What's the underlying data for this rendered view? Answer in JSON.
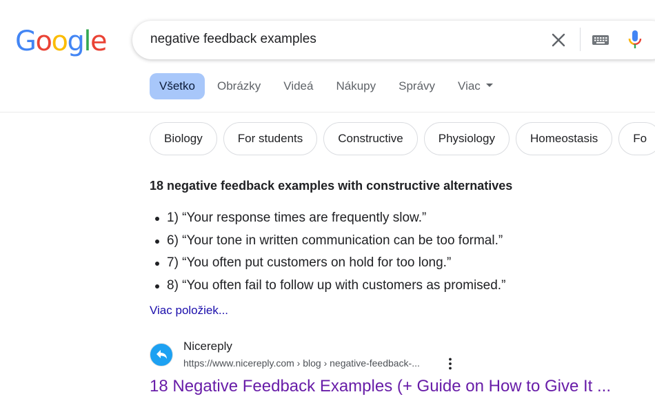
{
  "logo": {
    "letters": [
      "G",
      "o",
      "o",
      "g",
      "l",
      "e"
    ],
    "colors": [
      "#4285F4",
      "#EA4335",
      "#FBBC05",
      "#4285F4",
      "#34A853",
      "#EA4335"
    ]
  },
  "search": {
    "query": "negative feedback examples"
  },
  "icons": {
    "clear": "close-icon",
    "keyboard": "keyboard-icon",
    "mic": "microphone-icon",
    "more": "more-vert-icon"
  },
  "tabs": [
    {
      "label": "Všetko",
      "active": true
    },
    {
      "label": "Obrázky"
    },
    {
      "label": "Videá"
    },
    {
      "label": "Nákupy"
    },
    {
      "label": "Správy"
    },
    {
      "label": "Viac"
    }
  ],
  "chips": [
    "Biology",
    "For students",
    "Constructive",
    "Physiology",
    "Homeostasis",
    "Fo"
  ],
  "snippet": {
    "title": "18 negative feedback examples with constructive alternatives",
    "items": [
      "1) “Your response times are frequently slow.”",
      "6) “Your tone in written communication can be too formal.”",
      "7) “You often put customers on hold for too long.”",
      "8) “You often fail to follow up with customers as promised.”"
    ],
    "more_label": "Viac položiek..."
  },
  "result": {
    "site_name": "Nicereply",
    "url": "https://www.nicereply.com › blog › negative-feedback-...",
    "title": "18 Negative Feedback Examples (+ Guide on How to Give It ..."
  },
  "colors": {
    "tab_active_bg": "#a8c7fa",
    "visited_link": "#681da8",
    "link": "#1a0dab"
  }
}
